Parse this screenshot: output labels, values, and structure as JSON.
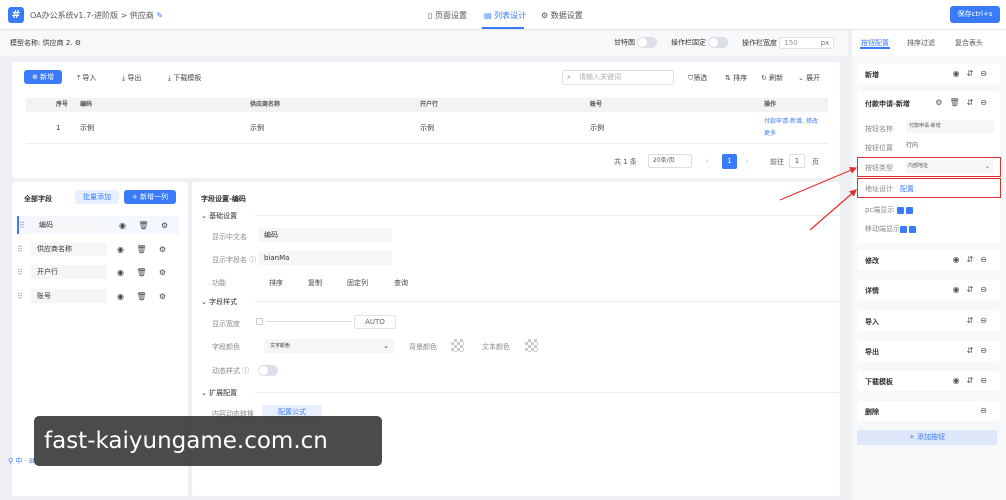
{
  "topbar": {
    "app_icon": "#",
    "breadcrumb_app": "OA办公系统v1.7-进阶版",
    "breadcrumb_sep": ">",
    "breadcrumb_page": "供应商",
    "tabs": [
      {
        "label": "页面设置",
        "icon": "page-icon"
      },
      {
        "label": "列表设计",
        "icon": "list-icon"
      },
      {
        "label": "数据设置",
        "icon": "data-icon"
      }
    ],
    "save_label": "保存ctrl+s"
  },
  "subbar": {
    "model_label": "模型名称:",
    "model_value": "供应商",
    "edit_glyph": "2.",
    "sticky_label": "甘特图",
    "fixed_label": "操作栏固定",
    "width_label": "操作栏宽度",
    "width_value": "150",
    "width_unit": "px"
  },
  "right_tabs": [
    "按钮配置",
    "排序过滤",
    "复合表头"
  ],
  "toolbar": {
    "add": "新增",
    "import": "导入",
    "export": "导出",
    "download_template": "下载模板",
    "search_placeholder": "请输入关键词",
    "filter": "筛选",
    "sort": "排序",
    "refresh": "刷新",
    "expand": "展开"
  },
  "table": {
    "columns": [
      "序号",
      "编码",
      "供应商名称",
      "开户行",
      "账号",
      "操作"
    ],
    "rows": [
      {
        "index": "1",
        "code": "示例",
        "name": "示例",
        "bank": "示例",
        "account": "示例",
        "actions": "付款申请-新增, 修改",
        "more": "更多"
      }
    ]
  },
  "pagination": {
    "total": "共 1 条",
    "page_size": "20条/页",
    "current": "1",
    "goto_label": "前往",
    "goto_value": "1",
    "page_unit": "页"
  },
  "fields_panel": {
    "title": "全部字段",
    "batch_add": "批量添加",
    "add_column": "+ 新增一列",
    "fields": [
      "编码",
      "供应商名称",
      "开户行",
      "账号"
    ]
  },
  "field_settings": {
    "title": "字段设置-编码",
    "basic_title": "基础设置",
    "display_name_label": "显示中文名",
    "display_name_value": "编码",
    "field_name_label": "显示字段名",
    "field_name_value": "bianMa",
    "features_label": "功能",
    "features": [
      "排序",
      "复制",
      "固定列",
      "查询"
    ],
    "style_title": "字段样式",
    "display_width_label": "显示宽度",
    "display_width_value": "AUTO",
    "font_color_label": "字段颜色",
    "font_color_select": "文字颜色",
    "bg_color_label": "背景颜色",
    "text_color_label": "文本颜色",
    "dynamic_style_label": "动态样式",
    "ext_title": "扩展配置",
    "content_convert_label": "内容动态转换",
    "config_formula": "配置公式"
  },
  "right_panel": {
    "items": [
      {
        "title": "新增"
      },
      {
        "title": "付款申请-新增"
      },
      {
        "title": "修改"
      },
      {
        "title": "详情"
      },
      {
        "title": "导入"
      },
      {
        "title": "导出"
      },
      {
        "title": "下载模板"
      },
      {
        "title": "删除"
      }
    ],
    "btn_name_label": "按钮名称",
    "btn_name_value": "付款申请-新增",
    "btn_position_label": "按钮位置",
    "btn_position_value": "行内",
    "btn_type_label": "按钮类型",
    "btn_type_value": "内部地址",
    "addr_label": "地址设计",
    "addr_value": "配置",
    "pc_label": "pc端显示",
    "mobile_label": "移动端显示",
    "add_button": "+ 添加按钮"
  },
  "footer_icons": "中 · ⊞",
  "watermark": "fast-kaiyungame.com.cn",
  "colors": {
    "accent": "#3a7bfd",
    "highlight": "#e03030"
  }
}
